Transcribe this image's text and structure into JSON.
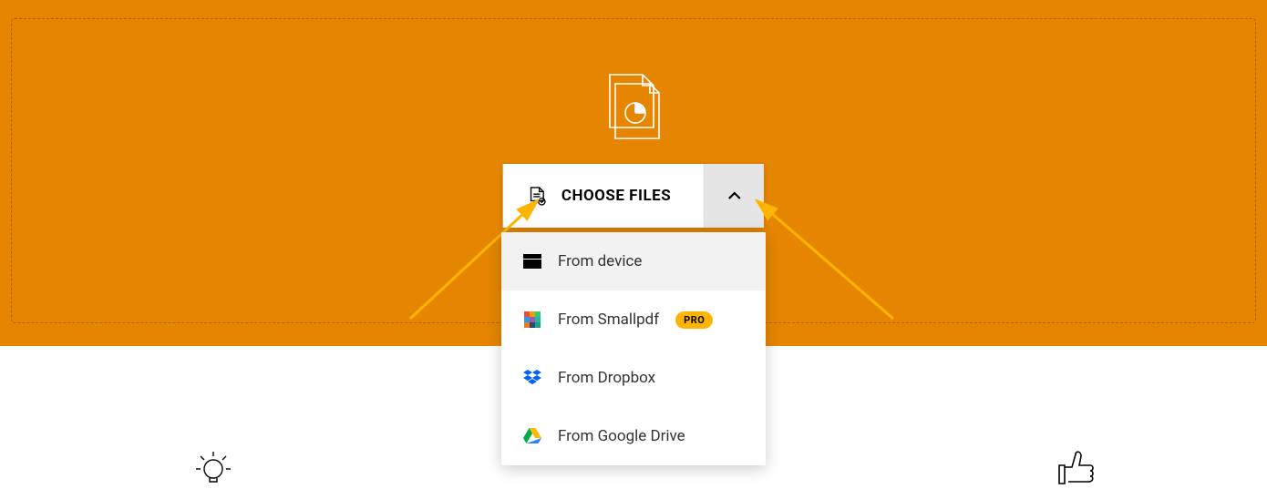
{
  "chooseFiles": {
    "label": "CHOOSE FILES"
  },
  "dropdown": {
    "fromDevice": "From device",
    "fromSmallpdf": "From Smallpdf",
    "proBadge": "PRO",
    "fromDropbox": "From Dropbox",
    "fromGoogleDrive": "From Google Drive"
  },
  "colors": {
    "accent": "#e68600",
    "arrow": "#ffb400"
  }
}
